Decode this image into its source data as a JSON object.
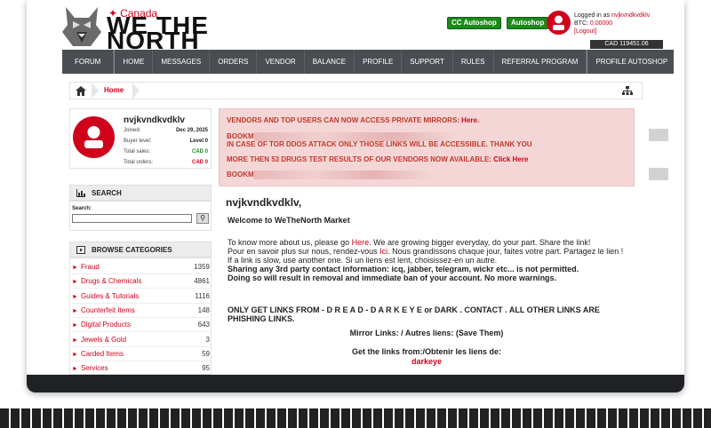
{
  "header": {
    "brand_country": "Canada",
    "brand_name": "WE THE NORTH",
    "btn_cc_autoshop": "CC Autoshop",
    "btn_autoshop": "Autoshop",
    "logged_in_prefix": "Logged in as ",
    "username": "nvjkvndkvdklv",
    "btc_label": "BTC: ",
    "btc_value": "0.00000",
    "logout": "[Logout]",
    "balance_tab": "CAD 119451.06"
  },
  "nav": {
    "items": [
      "FORUM",
      "HOME",
      "MESSAGES",
      "ORDERS",
      "VENDOR",
      "BALANCE",
      "PROFILE",
      "SUPPORT",
      "RULES",
      "REFERRAL PROGRAM",
      "PROFILE AUTOSHOP"
    ]
  },
  "breadcrumb": {
    "home": "Home"
  },
  "profile": {
    "name": "nvjkvndkvdklv",
    "joined_label": "Joined:",
    "joined_value": "Dec 29, 2025",
    "level_label": "Buyer level:",
    "level_value": "Level 0",
    "sales_label": "Total sales:",
    "sales_value": "CAD 0",
    "orders_label": "Total orders:",
    "orders_value": "CAD 0"
  },
  "search": {
    "heading": "SEARCH",
    "label": "Search:",
    "value": ""
  },
  "categories": {
    "heading": "BROWSE CATEGORIES",
    "items": [
      {
        "name": "Fraud",
        "count": "1359"
      },
      {
        "name": "Drugs & Chemicals",
        "count": "4861"
      },
      {
        "name": "Guides & Tutorials",
        "count": "1116"
      },
      {
        "name": "Counterfeit Items",
        "count": "148"
      },
      {
        "name": "Digital Products",
        "count": "643"
      },
      {
        "name": "Jewels & Gold",
        "count": "3"
      },
      {
        "name": "Carded Items",
        "count": "59"
      },
      {
        "name": "Services",
        "count": "95"
      }
    ]
  },
  "alert": {
    "line1": "VENDORS AND TOP USERS CAN NOW ACCESS PRIVATE MIRRORS: ",
    "line1_link": "Here.",
    "line2_prefix": "BOOKM",
    "line3": "IN CASE OF TOR DDOS ATTACK ONLY THOSE LINKS WILL BE ACCESSIBLE. THANK YOU",
    "line4": "MORE THEN 53 DRUGS TEST RESULTS OF OUR VENDORS NOW AVAILABLE: ",
    "line4_link": "Click Here",
    "line5_prefix": "BOOKM"
  },
  "main": {
    "title": "nvjkvndkvdklv,",
    "welcome": "Welcome to WeTheNorth Market",
    "p1_a": "To know more about us, please go ",
    "p1_link": "Here",
    "p1_b": ". We are growing bigger everyday, do your part. Share the link!",
    "p2_a": "Pour en savoir plus sur nous, rendez-vous ",
    "p2_link": "Ici",
    "p2_b": ". Nous grandissons chaque jour, faites votre part. Partagez le lien !",
    "p3": "If a link is slow, use another one. Si un liens est lent, choisissez-en un autre.",
    "p4": "Sharing any 3rd party contact information: icq, jabber, telegram, wickr etc... is not permitted.",
    "p5": "Doing so will result in removal and immediate ban of your account. No more warnings.",
    "only_links": "ONLY GET LINKS FROM - D R E A D - D A R K E Y E or DARK . CONTACT . ALL OTHER LINKS ARE PHISHING LINKS.",
    "mirror": "Mirror Links: / Autres liens: (Save Them)",
    "get_links": "Get the links from:/Obtenir les liens de:",
    "darkeye": "darkeye"
  },
  "colors": {
    "accent": "#d0021b",
    "nav_bg": "#4a4d52",
    "alert_bg": "#f5d6d6",
    "button_green": "#1a8a1a"
  },
  "icons": {
    "logo": "wolf-head-icon",
    "flag": "maple-leaf-icon",
    "home": "home-icon",
    "tree": "sitemap-icon",
    "user": "user-icon",
    "chart": "bar-chart-icon",
    "play": "play-square-icon",
    "search": "magnifier-icon"
  }
}
